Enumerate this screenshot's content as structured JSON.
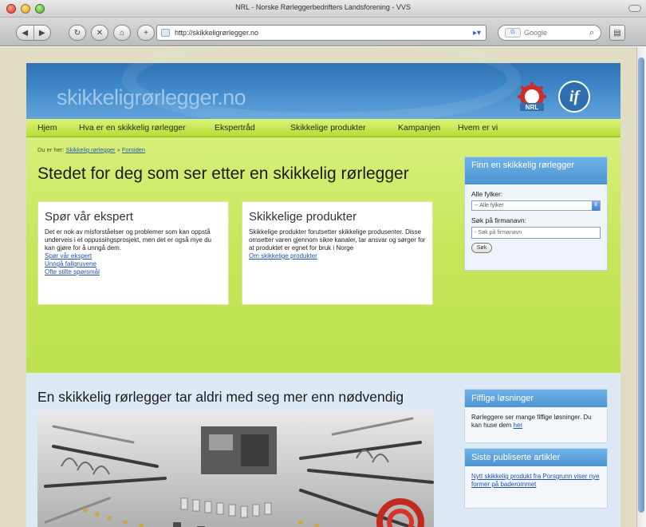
{
  "window": {
    "title": "NRL - Norske Rørleggerbedrifters Landsforening - VVS"
  },
  "toolbar": {
    "url": "http://skikkeligrørlegger.no",
    "search_placeholder": "Google",
    "search_engine_label": "G"
  },
  "site": {
    "logo_text": "skikkeligrørlegger.no",
    "nrl_logo_text": "NRL",
    "if_logo_text": "if"
  },
  "nav": {
    "items": [
      {
        "label": "Hjem"
      },
      {
        "label": "Hva er en skikkelig rørlegger"
      },
      {
        "label": "Ekspertråd"
      },
      {
        "label": "Skikkelige produkter"
      },
      {
        "label": "Kampanjen"
      },
      {
        "label": "Hvem er vi"
      }
    ]
  },
  "breadcrumb": {
    "prefix": "Du er her:",
    "link1": "Skikkelig rørlegger",
    "separator": "»",
    "link2": "Forsiden"
  },
  "main": {
    "heading": "Stedet for deg som ser etter en skikkelig rørlegger",
    "expert": {
      "title": "Spør vår ekspert",
      "body": "Det er nok av misforståelser og problemer som kan oppstå underveis i et oppussingsprosjekt, men det er også mye du kan gjøre for å unngå dem.",
      "links": [
        "Spør vår ekspert",
        "Unngå fallgruvene",
        "Ofte stilte spørsmål"
      ]
    },
    "products": {
      "title": "Skikkelige produkter",
      "body": "Skikkelige produkter forutsetter skikkelige produsenter. Disse omsetter varen gjennom sikre kanaler, tar ansvar og sørger for at produktet er egnet for bruk i Norge",
      "link": "Om skikkelige produkter"
    },
    "heading2": "En skikkelig rørlegger tar aldri med seg mer enn nødvendig"
  },
  "finder": {
    "title": "Finn en skikkelig rørlegger",
    "county_label": "Alle fylker:",
    "county_value": "-- Alle fylker",
    "name_label": "Søk på firmanavn:",
    "name_placeholder": "- Søk på firmanavn",
    "button": "Søk"
  },
  "tips": {
    "title": "Fiffige løsninger",
    "body": "Rørleggere ser mange fiffige løsninger. Du kan huse dem",
    "link": "her"
  },
  "articles": {
    "title": "Siste publiserte artikler",
    "link": "Nytt skikkelig produkt fra Porsgrunn viser nye former på baderommet"
  }
}
